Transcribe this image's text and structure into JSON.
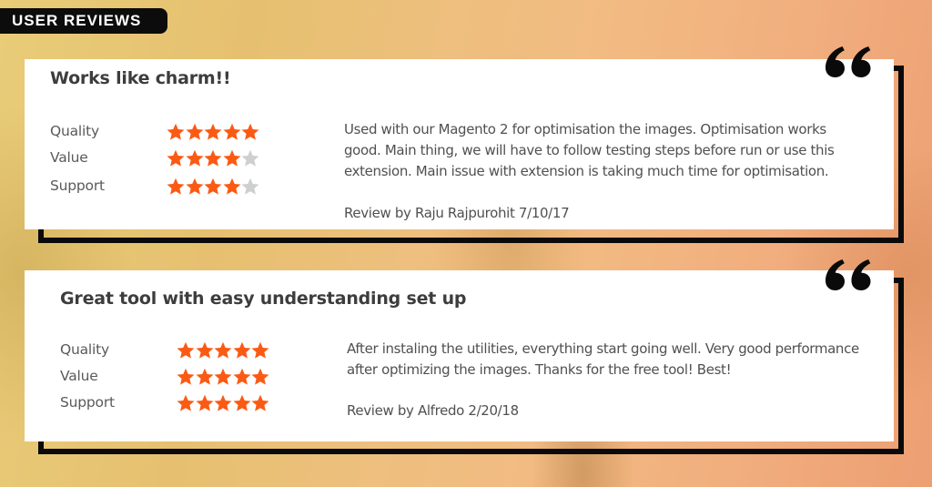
{
  "header": {
    "badge_label": "USER REVIEWS"
  },
  "colors": {
    "star_filled": "#fb5a14",
    "star_empty": "#cfcfcf",
    "frame": "#0a0a0a"
  },
  "reviews": [
    {
      "title": "Works like charm!!",
      "ratings": [
        {
          "label": "Quality",
          "stars": 5,
          "max": 5
        },
        {
          "label": "Value",
          "stars": 4,
          "max": 5
        },
        {
          "label": "Support",
          "stars": 4,
          "max": 5
        }
      ],
      "body_lines": [
        "Used with our Magento 2 for optimisation the images. Optimisation works",
        "good. Main thing, we will have to follow testing steps before run or use this",
        "extension. Main issue with extension is taking much time for optimisation."
      ],
      "byline": "Review by Raju Rajpurohit 7/10/17",
      "quote_icon": "quote-open-icon"
    },
    {
      "title": "Great tool with easy understanding set up",
      "ratings": [
        {
          "label": "Quality",
          "stars": 5,
          "max": 5
        },
        {
          "label": "Value",
          "stars": 5,
          "max": 5
        },
        {
          "label": "Support",
          "stars": 5,
          "max": 5
        }
      ],
      "body_lines": [
        "After instaling the utilities, everything start going well. Very good performance",
        "after optimizing the images. Thanks for the free tool! Best!"
      ],
      "byline": "Review by Alfredo 2/20/18",
      "quote_icon": "quote-open-icon"
    }
  ]
}
